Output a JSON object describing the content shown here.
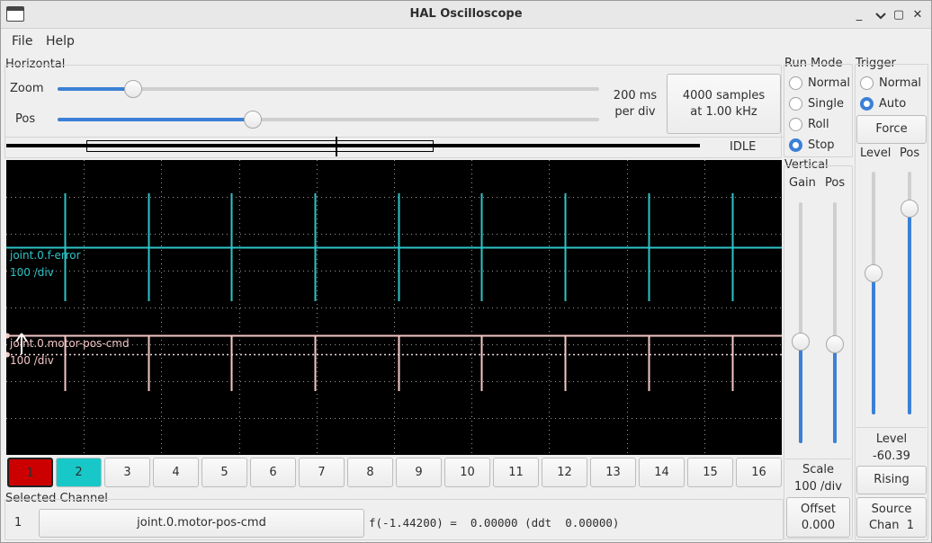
{
  "window": {
    "title": "HAL Oscilloscope",
    "minimize": "_",
    "maximize": "▢",
    "close": "✕"
  },
  "menu": [
    "File",
    "Help"
  ],
  "horizontal": {
    "title": "Horizontal",
    "zoom_label": "Zoom",
    "pos_label": "Pos",
    "zoom_level": 0.14,
    "pos_level": 0.36,
    "rate_line1": "200 ms",
    "rate_line2": "per div",
    "samples_line1": "4000 samples",
    "samples_line2": "at 1.00 kHz",
    "status": "IDLE"
  },
  "run_mode": {
    "title": "Run Mode",
    "options": [
      "Normal",
      "Single",
      "Roll",
      "Stop"
    ],
    "selected": "Stop"
  },
  "trigger": {
    "title": "Trigger",
    "options": [
      "Normal",
      "Auto"
    ],
    "selected": "Auto",
    "force_label": "Force",
    "level_label": "Level",
    "pos_label": "Pos",
    "level_slider": 0.58,
    "pos_slider": 0.85,
    "level_caption": "Level",
    "level_value": "-60.39",
    "edge_label": "Rising",
    "source_line1": "Source",
    "source_line2": "Chan  1"
  },
  "vertical": {
    "title": "Vertical",
    "gain_label": "Gain",
    "pos_label": "Pos",
    "gain_level": 0.42,
    "pos_level": 0.41,
    "scale_label": "Scale",
    "scale_value": "100 /div",
    "offset_label": "Offset",
    "offset_value": "0.000"
  },
  "traces": [
    {
      "name": "joint.0.f-error",
      "scale": "100 /div",
      "color": "#2ec4c8"
    },
    {
      "name": "joint.0.motor-pos-cmd",
      "scale": "100 /div",
      "color": "#f4c6c6"
    }
  ],
  "channels": [
    "1",
    "2",
    "3",
    "4",
    "5",
    "6",
    "7",
    "8",
    "9",
    "10",
    "11",
    "12",
    "13",
    "14",
    "15",
    "16"
  ],
  "channel_colors": {
    "1": "#cc0000",
    "2": "#18c8c8"
  },
  "selected_channel": {
    "title": "Selected Channel",
    "number": "1",
    "name": "joint.0.motor-pos-cmd",
    "readout": "f(-1.44200) =  0.00000 (ddt  0.00000)"
  }
}
